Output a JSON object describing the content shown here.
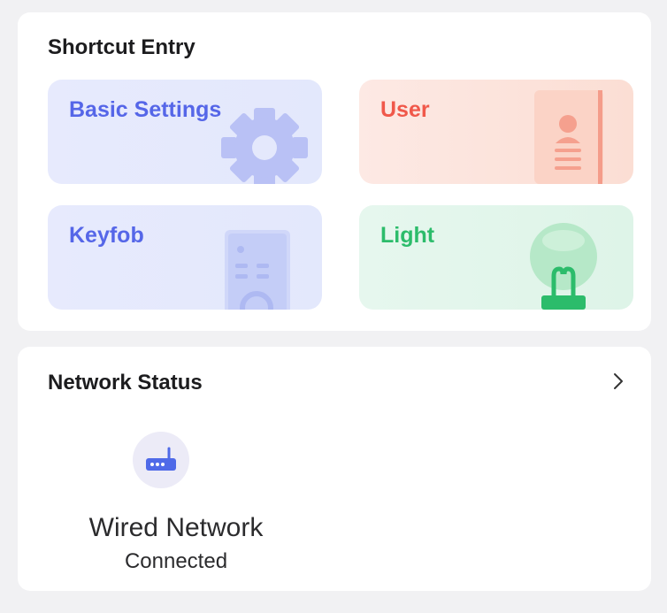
{
  "shortcut_entry": {
    "title": "Shortcut Entry",
    "tiles": [
      {
        "label": "Basic Settings",
        "icon": "gear-icon",
        "color": "#5566e8"
      },
      {
        "label": "User",
        "icon": "user-card-icon",
        "color": "#f0584a"
      },
      {
        "label": "Keyfob",
        "icon": "keyfob-icon",
        "color": "#5566e8"
      },
      {
        "label": "Light",
        "icon": "light-bulb-icon",
        "color": "#2cbc6b"
      }
    ]
  },
  "network_status": {
    "title": "Network Status",
    "chevron_icon": "chevron-right-icon",
    "items": [
      {
        "name": "Wired Network",
        "status": "Connected",
        "icon": "router-icon"
      }
    ]
  }
}
